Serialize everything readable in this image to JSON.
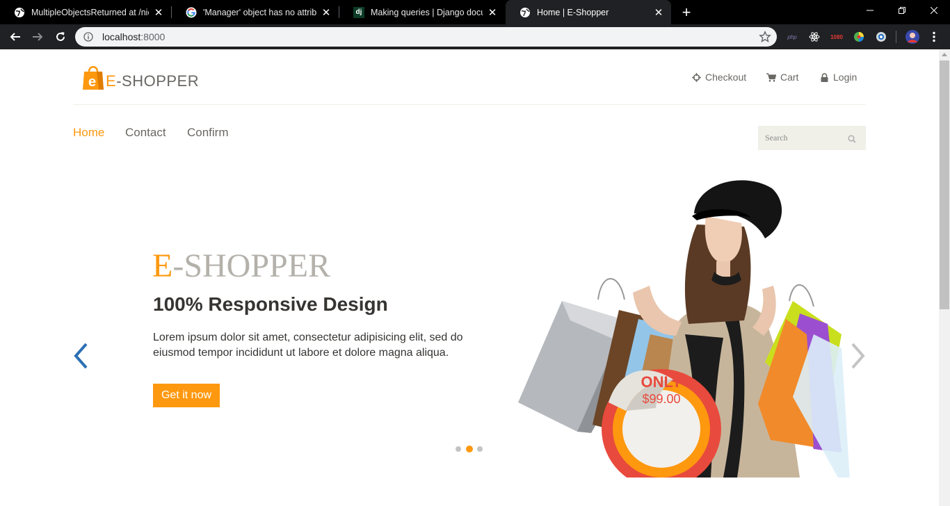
{
  "browser": {
    "tabs": [
      {
        "title": "MultipleObjectsReturned at /nior",
        "icon": "globe-icon",
        "active": false
      },
      {
        "title": "'Manager' object has no attribute",
        "icon": "google-icon",
        "active": false
      },
      {
        "title": "Making queries | Django docume",
        "icon": "django-icon",
        "active": false
      },
      {
        "title": "Home | E-Shopper",
        "icon": "globe-icon",
        "active": true
      }
    ],
    "url_host": "localhost",
    "url_port": ":8000",
    "extensions": [
      "php",
      "1080"
    ]
  },
  "header": {
    "logo_prefix": "E",
    "logo_rest": "-SHOPPER",
    "bag_letter": "e",
    "user_nav": [
      {
        "label": "Checkout",
        "icon": "crosshairs-icon"
      },
      {
        "label": "Cart",
        "icon": "cart-icon"
      },
      {
        "label": "Login",
        "icon": "lock-icon"
      }
    ]
  },
  "nav": {
    "items": [
      {
        "label": "Home",
        "active": true
      },
      {
        "label": "Contact",
        "active": false
      },
      {
        "label": "Confirm",
        "active": false
      }
    ],
    "search_placeholder": "Search"
  },
  "slider": {
    "title_first": "E",
    "title_rest": "-SHOPPER",
    "subtitle": "100% Responsive Design",
    "description": "Lorem ipsum dolor sit amet, consectetur adipisicing elit, sed do eiusmod tempor incididunt ut labore et dolore magna aliqua.",
    "button": "Get it now",
    "badge_only": "ONLY",
    "badge_price": "$99.00",
    "dots": 3,
    "active_dot": 1
  },
  "colors": {
    "accent": "#FE980F",
    "text": "#696763",
    "badge_red": "#E84A3D"
  }
}
